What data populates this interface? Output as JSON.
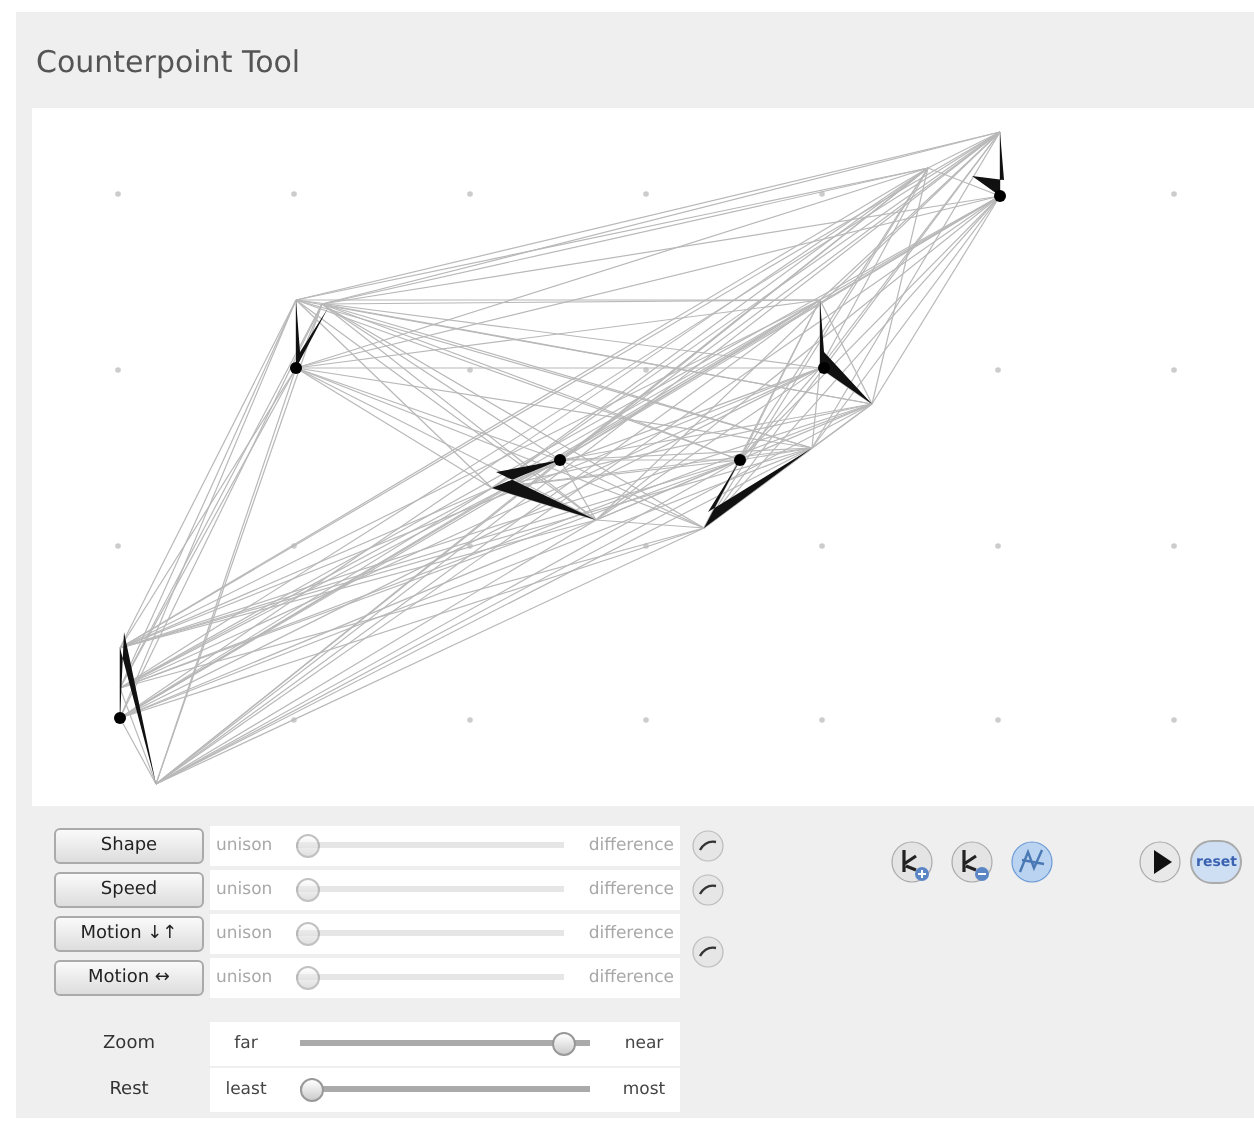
{
  "window": {
    "title": "Counterpoint Tool"
  },
  "voice_sliders": [
    {
      "button": "Shape",
      "left": "unison",
      "right": "difference",
      "level": 0,
      "disabled": true
    },
    {
      "button": "Speed",
      "left": "unison",
      "right": "difference",
      "level": 0,
      "disabled": true
    },
    {
      "button": "Motion ↓↑",
      "left": "unison",
      "right": "difference",
      "level": 0,
      "disabled": true
    },
    {
      "button": "Motion ↔",
      "left": "unison",
      "right": "difference",
      "level": 0,
      "disabled": true
    }
  ],
  "view_sliders": [
    {
      "label": "Zoom",
      "left": "far",
      "right": "near",
      "level": 0.95
    },
    {
      "label": "Rest",
      "left": "least",
      "right": "most",
      "level": 0
    }
  ],
  "tools": [
    {
      "kind": "add",
      "selected": false
    },
    {
      "kind": "remove",
      "selected": false
    },
    {
      "kind": "select",
      "selected": true
    }
  ],
  "play_button": {
    "kind": "play"
  },
  "reset_button": {
    "label": "reset"
  }
}
